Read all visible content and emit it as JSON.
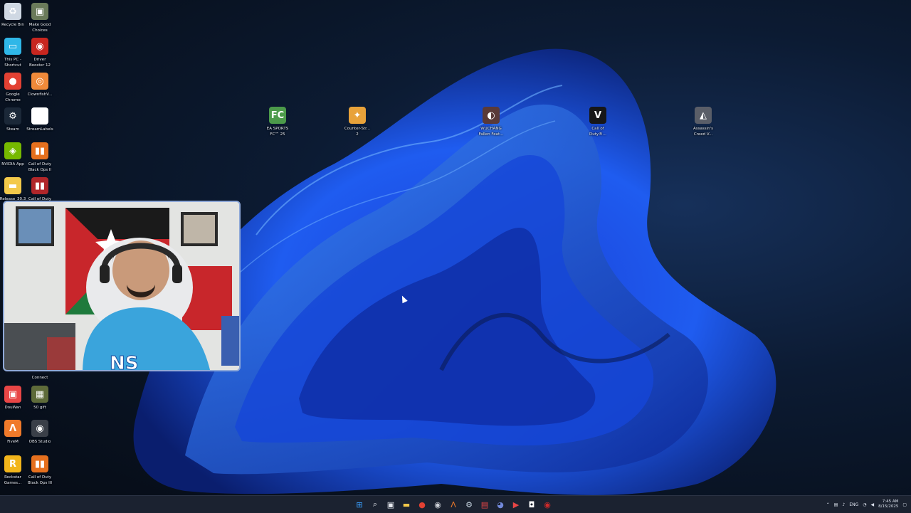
{
  "desktop": {
    "left_column_icons": [
      {
        "name": "recycle-bin-icon",
        "label": "Recycle Bin",
        "color": "#cfd8e3",
        "glyph": "♻"
      },
      {
        "name": "make-good-choices-icon",
        "label": "Make Good\nChoices",
        "color": "#6b7b5a",
        "glyph": "▣"
      },
      {
        "name": "this-pc-icon",
        "label": "This PC -\nShortcut",
        "color": "#2fb7e8",
        "glyph": "▭"
      },
      {
        "name": "driver-booster-icon",
        "label": "Driver\nBooster 12",
        "color": "#c8261f",
        "glyph": "◉"
      },
      {
        "name": "google-chrome-icon",
        "label": "Google\nChrome",
        "color": "#e34133",
        "glyph": "●"
      },
      {
        "name": "clownfish-icon",
        "label": "ClownfishV...",
        "color": "#f08a3a",
        "glyph": "◎"
      },
      {
        "name": "steam-icon",
        "label": "Steam",
        "color": "#1b2838",
        "glyph": "⚙"
      },
      {
        "name": "streamlabels-icon",
        "label": "StreamLabels",
        "color": "#ffffff",
        "glyph": "◘"
      },
      {
        "name": "nvidia-app-icon",
        "label": "NVIDIA App",
        "color": "#76b900",
        "glyph": "◈"
      },
      {
        "name": "call-of-duty-bo2-icon",
        "label": "Call of Duty\nBlack Ops II",
        "color": "#e5701e",
        "glyph": "▮▮"
      },
      {
        "name": "release-folder-icon",
        "label": "Release_30.3",
        "color": "#f3c94a",
        "glyph": "▬"
      },
      {
        "name": "call-of-duty-icon",
        "label": "Call of Duty",
        "color": "#b0262a",
        "glyph": "▮▮"
      }
    ],
    "lower_left_icons": [
      {
        "name": "connect-icon",
        "label": "Connect",
        "color": "#2a2f3a",
        "glyph": ""
      },
      {
        "name": "douwan-icon",
        "label": "DouWan",
        "color": "#e84646",
        "glyph": "▣"
      },
      {
        "name": "50-gift-icon",
        "label": "50 gift",
        "color": "#5e6b3a",
        "glyph": "▦"
      },
      {
        "name": "fivem-icon",
        "label": "FiveM",
        "color": "#f07a2a",
        "glyph": "Λ"
      },
      {
        "name": "obs-studio-icon",
        "label": "OBS Studio",
        "color": "#3a3f48",
        "glyph": "◉"
      },
      {
        "name": "rockstar-games-icon",
        "label": "Rockstar\nGames...",
        "color": "#f2b51b",
        "glyph": "R"
      },
      {
        "name": "call-of-duty-bo3-icon",
        "label": "Call of Duty\nBlack Ops III",
        "color": "#e5701e",
        "glyph": "▮▮"
      }
    ],
    "top_row_icons": [
      {
        "name": "ea-sports-fc25-icon",
        "label": "EA SPORTS\nFC™ 25",
        "color": "#4c9a4a",
        "glyph": "FC"
      },
      {
        "name": "counter-strike-icon",
        "label": "Counter-Str...\n2",
        "color": "#e8a23a",
        "glyph": "✦"
      },
      {
        "name": "wuchang-icon",
        "label": "WUCHANG\nFallen Feat...",
        "color": "#5a3a38",
        "glyph": "◐"
      },
      {
        "name": "call-of-duty-top-icon",
        "label": "Call of\nDuty®...",
        "color": "#171717",
        "glyph": "V"
      },
      {
        "name": "assassins-creed-icon",
        "label": "Assassin's\nCreed V...",
        "color": "#5a5e68",
        "glyph": "◭"
      }
    ]
  },
  "webcam": {
    "logo_text": "NS"
  },
  "taskbar": {
    "apps": [
      {
        "name": "start-button",
        "glyph": "⊞",
        "color": "#3aa0ff"
      },
      {
        "name": "search-icon",
        "glyph": "⌕",
        "color": "#e6e9ef"
      },
      {
        "name": "task-view-icon",
        "glyph": "▣",
        "color": "#e6e9ef"
      },
      {
        "name": "file-explorer-icon",
        "glyph": "▬",
        "color": "#f3c94a"
      },
      {
        "name": "chrome-taskbar-icon",
        "glyph": "●",
        "color": "#e34133"
      },
      {
        "name": "obs-taskbar-icon",
        "glyph": "◉",
        "color": "#cfd3da"
      },
      {
        "name": "fivem-taskbar-icon",
        "glyph": "Λ",
        "color": "#f07a2a"
      },
      {
        "name": "steam-taskbar-icon",
        "glyph": "⚙",
        "color": "#c7d5e0"
      },
      {
        "name": "app-taskbar-icon",
        "glyph": "▤",
        "color": "#e84646"
      },
      {
        "name": "discord-taskbar-icon",
        "glyph": "◕",
        "color": "#7289da"
      },
      {
        "name": "media-taskbar-icon",
        "glyph": "▶",
        "color": "#e84646"
      },
      {
        "name": "streamlabels-taskbar-icon",
        "glyph": "◘",
        "color": "#ffffff"
      },
      {
        "name": "record-taskbar-icon",
        "glyph": "◉",
        "color": "#d12a2a"
      }
    ],
    "tray": {
      "language": "ENG",
      "time": "7:45 AM",
      "date": "8/15/2025"
    }
  }
}
